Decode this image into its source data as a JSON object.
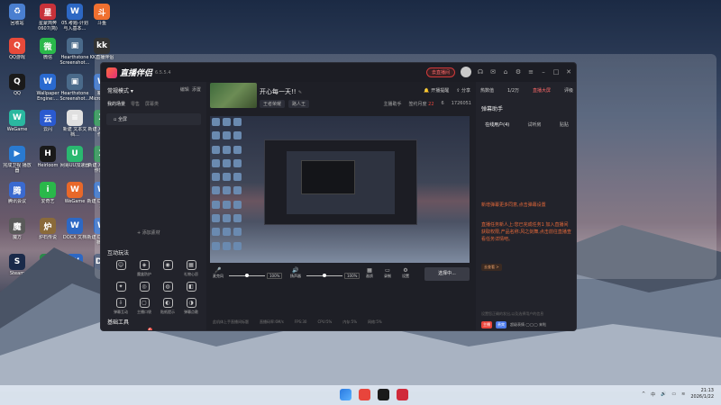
{
  "desktop": {
    "icons": [
      {
        "label": "回收站",
        "color": "#4a7fd0",
        "glyph": "♻"
      },
      {
        "label": "星蒙简奔 0607(简)",
        "color": "#c8323a",
        "glyph": "星"
      },
      {
        "label": "05.考题-计划 与入基本…",
        "color": "#2d68c4",
        "glyph": "W"
      },
      {
        "label": "斗鱼",
        "color": "#f07030",
        "glyph": "斗"
      },
      {
        "label": "QQ游戏",
        "color": "#e84a3a",
        "glyph": "Q"
      },
      {
        "label": "微信",
        "color": "#2ab84a",
        "glyph": "微"
      },
      {
        "label": "Hearthstone Screenshot…",
        "color": "#4a6a8a",
        "glyph": "▣"
      },
      {
        "label": "KK直播伴侣",
        "color": "#333",
        "glyph": "kk"
      },
      {
        "label": "QQ",
        "color": "#1a1a1a",
        "glyph": "Q"
      },
      {
        "label": "Wallpaper Engine:…",
        "color": "#2a6ad0",
        "glyph": "W"
      },
      {
        "label": "Hearthstone Screenshot…",
        "color": "#4a6a8a",
        "glyph": "▣"
      },
      {
        "label": "新建 Microsoft…",
        "color": "#2d68c4",
        "glyph": "W"
      },
      {
        "label": "WeGame",
        "color": "#2ab8a0",
        "glyph": "W"
      },
      {
        "label": "云闪",
        "color": "#2a5ad0",
        "glyph": "云"
      },
      {
        "label": "新建 文本文档…",
        "color": "#e0e0e0",
        "glyph": "≡"
      },
      {
        "label": "新建 XLSX 工作表",
        "color": "#1f8a4a",
        "glyph": "X"
      },
      {
        "label": "完成卫视 播放器",
        "color": "#2a7ad0",
        "glyph": "▶"
      },
      {
        "label": "Heirloom",
        "color": "#1a1a1a",
        "glyph": "H"
      },
      {
        "label": "网易UU加速器",
        "color": "#2ab870",
        "glyph": "U"
      },
      {
        "label": "新建 XLSX 工作表(2)",
        "color": "#1f8a4a",
        "glyph": "X"
      },
      {
        "label": "腾讯会议",
        "color": "#3a6ad0",
        "glyph": "腾"
      },
      {
        "label": "爱奇艺",
        "color": "#2ab84a",
        "glyph": "i"
      },
      {
        "label": "WeGame",
        "color": "#e8682a",
        "glyph": "W"
      },
      {
        "label": "新建 DOCX 文档",
        "color": "#2d68c4",
        "glyph": "W"
      },
      {
        "label": "魔方",
        "color": "#5a5a5a",
        "glyph": "魔"
      },
      {
        "label": "炉石传说",
        "color": "#8a6a3a",
        "glyph": "炉"
      },
      {
        "label": "DOCX 文档",
        "color": "#2d68c4",
        "glyph": "W"
      },
      {
        "label": "新建 DOCX 文档(2)",
        "color": "#2d68c4",
        "glyph": "W"
      },
      {
        "label": "Steam",
        "color": "#1a2a4a",
        "glyph": "S"
      },
      {
        "label": "三角洲行动",
        "color": "#2a8a4a",
        "glyph": "▲"
      },
      {
        "label": "校企实施合作 业务策划稿…",
        "color": "#2d68c4",
        "glyph": "W"
      },
      {
        "label": "DirectX OX 修复工具",
        "color": "#3a4a6a",
        "glyph": "DX"
      },
      {
        "label": "炉石传说盒子",
        "color": "#8a6a3a",
        "glyph": "炉"
      },
      {
        "label": "主播能活策划 任务书…",
        "color": "#2d68c4",
        "glyph": "W"
      },
      {
        "label": "腾讯视频",
        "color": "#2aa0e0",
        "glyph": "▶"
      },
      {
        "label": "炉石传说",
        "color": "#8a6a3a",
        "glyph": "炉"
      },
      {
        "label": "新建 XLSX 工作表",
        "color": "#1f8a4a",
        "glyph": "X"
      }
    ]
  },
  "app": {
    "name": "直播伴侣",
    "version": "6.5.5.4",
    "titlebar": {
      "live_btn": "去直播间",
      "icons": [
        "headset-icon",
        "chat-icon",
        "store-icon",
        "settings-icon",
        "menu-icon",
        "minimize-icon",
        "maximize-icon",
        "close-icon"
      ]
    },
    "left": {
      "mode": "常规模式",
      "edit": "编辑",
      "more": "添置",
      "scene_title": "我的场景",
      "scene_tabs": [
        "我的场景",
        "零售",
        "屏幕类"
      ],
      "scene_items": [
        "全屏"
      ],
      "add_material": "+ 添加素材",
      "interact_title": "互动玩法",
      "interact_tools": [
        {
          "label": "",
          "glyph": "☺"
        },
        {
          "label": "魔盒防护",
          "glyph": "◈"
        },
        {
          "label": "",
          "glyph": "◉"
        },
        {
          "label": "礼物心愿",
          "glyph": "▦"
        },
        {
          "label": "",
          "glyph": "✦"
        },
        {
          "label": "",
          "glyph": "◎"
        },
        {
          "label": "",
          "glyph": "◍"
        },
        {
          "label": "",
          "glyph": "◧"
        },
        {
          "label": "弹幕互动",
          "glyph": "⇩"
        },
        {
          "label": "主播口袋",
          "glyph": "▢"
        },
        {
          "label": "贴纸提示",
          "glyph": "◐"
        },
        {
          "label": "弹幕点歌",
          "glyph": "◑"
        }
      ],
      "basic_title": "基础工具",
      "basic_tools": [
        {
          "label": "任务中心",
          "glyph": "✓",
          "badge": ""
        },
        {
          "label": "直播任务",
          "glyph": "▣",
          "badge": "6"
        },
        {
          "label": "福利预告",
          "glyph": "◫",
          "badge": ""
        },
        {
          "label": "正能量合",
          "glyph": "⇩",
          "badge": ""
        },
        {
          "label": "弹幕清单",
          "glyph": "▦",
          "badge": ""
        },
        {
          "label": "直播数据",
          "glyph": "▤",
          "badge": ""
        },
        {
          "label": "连麦设置",
          "glyph": "▥",
          "badge": ""
        },
        {
          "label": "下播设置",
          "glyph": "▧",
          "badge": ""
        }
      ],
      "more_tools": "··· 更多功能"
    },
    "center": {
      "title": "开心每一天!!",
      "tags": [
        "王者荣耀",
        "路人王"
      ],
      "actions": [
        "开播提醒",
        "分享"
      ],
      "stats": [
        "主播助手",
        "签约月度",
        "22",
        "6",
        "1726051"
      ],
      "controls": {
        "mic_label": "麦克风",
        "mic_pct": "100%",
        "speaker_label": "扬声器",
        "speaker_pct": "100%",
        "mic_level": 0.5,
        "speaker_level": 0.5,
        "buttons": [
          "画质",
          "录制",
          "设置"
        ],
        "start": "选择中..."
      },
      "status": [
        "此机体上手直播间标题",
        "直播码率:6M/s",
        "FPS:30",
        "CPU:5%",
        "内存:5%",
        "网络:5%",
        "帧率:0"
      ]
    },
    "right": {
      "top_tabs": [
        "热数值",
        "1/2万",
        "直播大屏",
        "评级"
      ],
      "title": "弹幕助手",
      "tabs": [
        "在线用户(4)",
        "试听房",
        "贴贴"
      ],
      "notices": [
        "新增弹幕更多同意,点击弹幕设置",
        "直播任务新人上:您已完成任务1 加入直播间获取权限,产品名称:风之剑舞,点击前往直播查看任务详情吧。"
      ],
      "chip_label": "去查看 >",
      "input_placeholder": "设置您正确的发出,以及选择用户的信息",
      "bottom_tags": [
        "主播",
        "贵宾",
        "超级表情 ◯◯◯ 来啦"
      ]
    }
  },
  "taskbar": {
    "apps": [
      "windows-start-icon",
      "weibo-icon",
      "douyin-icon",
      "netease-icon"
    ],
    "time": "21:13",
    "date": "2026/1/22",
    "tray": [
      "chevron-up-icon",
      "lang-icon",
      "sound-icon",
      "battery-icon",
      "wifi-icon"
    ]
  }
}
